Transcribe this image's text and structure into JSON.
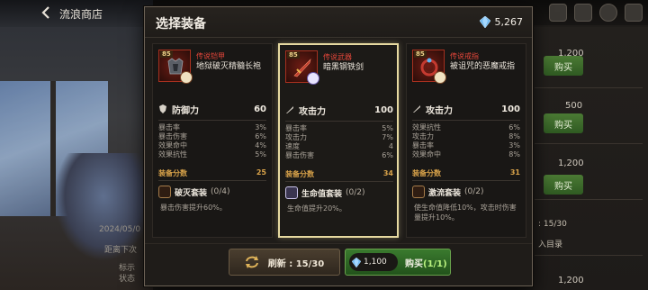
{
  "background": {
    "shop_title": "流浪商店",
    "date_fragment": "2024/05/0",
    "next_fragment": "距离下次",
    "side_text_1": "标示",
    "side_text_2": "状态",
    "list": [
      {
        "price": "1,200",
        "buy_label": "购买"
      },
      {
        "price": "500",
        "buy_label": "购买"
      },
      {
        "price": "1,200",
        "buy_label": "购买"
      },
      {
        "price": "1,200",
        "buy_label": "购买"
      }
    ],
    "refresh_fragment": ": 15/30",
    "catalog_fragment": "入目录"
  },
  "dialog": {
    "title": "选择装备",
    "currency": "5,267"
  },
  "items": [
    {
      "level": "85",
      "type": "传说铠甲",
      "name": "地狱破灭精髓长袍",
      "main_stat": {
        "label": "防御力",
        "value": "60"
      },
      "substats": [
        {
          "label": "暴击率",
          "value": "3%"
        },
        {
          "label": "暴击伤害",
          "value": "6%"
        },
        {
          "label": "效果命中",
          "value": "4%"
        },
        {
          "label": "效果抗性",
          "value": "5%"
        }
      ],
      "score_label": "装备分数",
      "score": "25",
      "set_name": "破灭套装",
      "set_count": "(0/4)",
      "set_desc": "暴击伤害提升60%。",
      "accent": "#a8301f"
    },
    {
      "level": "85",
      "type": "传说武器",
      "name": "暗黑钢铁剑",
      "main_stat": {
        "label": "攻击力",
        "value": "100"
      },
      "substats": [
        {
          "label": "暴击率",
          "value": "5%"
        },
        {
          "label": "攻击力",
          "value": "7%"
        },
        {
          "label": "速度",
          "value": "4"
        },
        {
          "label": "暴击伤害",
          "value": "6%"
        }
      ],
      "score_label": "装备分数",
      "score": "34",
      "set_name": "生命值套装",
      "set_count": "(0/2)",
      "set_desc": "生命值提升20%。",
      "accent": "#a8301f"
    },
    {
      "level": "85",
      "type": "传说戒指",
      "name": "被诅咒的恶魔戒指",
      "main_stat": {
        "label": "攻击力",
        "value": "100"
      },
      "substats": [
        {
          "label": "效果抗性",
          "value": "6%"
        },
        {
          "label": "攻击力",
          "value": "8%"
        },
        {
          "label": "暴击率",
          "value": "3%"
        },
        {
          "label": "效果命中",
          "value": "8%"
        }
      ],
      "score_label": "装备分数",
      "score": "31",
      "set_name": "激流套装",
      "set_count": "(0/2)",
      "set_desc": "使生命值降低10%，攻击时伤害量提升10%。",
      "accent": "#a8301f"
    }
  ],
  "footer": {
    "refresh_label": "刷新 : 15/30",
    "buy_price": "1,100",
    "buy_label": "购买",
    "buy_count": "(1/1)"
  }
}
